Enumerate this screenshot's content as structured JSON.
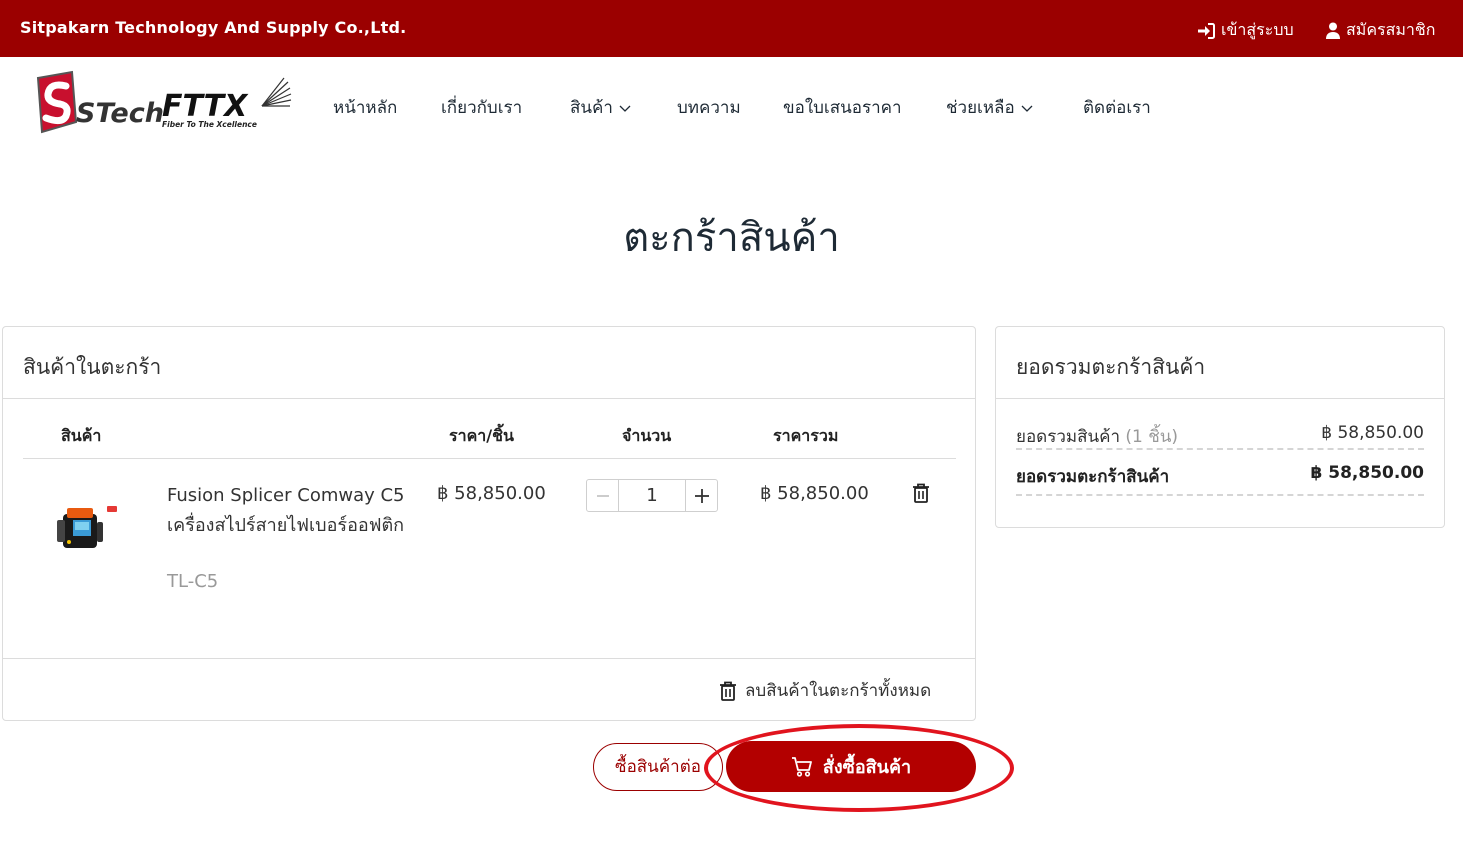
{
  "topbar": {
    "company": "Sitpakarn Technology And Supply Co.,Ltd.",
    "login_label": "เข้าสู่ระบบ",
    "register_label": "สมัครสมาชิก",
    "login_icon": "sign-in-icon",
    "register_icon": "user-icon",
    "bg_color": "#9b0000"
  },
  "logo": {
    "brand": "STech",
    "sub_brand": "FTTX",
    "tagline": "Fiber To The Xcellence"
  },
  "nav": {
    "items": [
      {
        "label": "หน้าหลัก",
        "dropdown": false
      },
      {
        "label": "เกี่ยวกับเรา",
        "dropdown": false
      },
      {
        "label": "สินค้า",
        "dropdown": true
      },
      {
        "label": "บทความ",
        "dropdown": false
      },
      {
        "label": "ขอใบเสนอราคา",
        "dropdown": false
      },
      {
        "label": "ช่วยเหลือ",
        "dropdown": true
      },
      {
        "label": "ติดต่อเรา",
        "dropdown": false
      }
    ]
  },
  "page": {
    "title": "ตะกร้าสินค้า"
  },
  "cart": {
    "heading": "สินค้าในตะกร้า",
    "columns": {
      "product": "สินค้า",
      "unit_price": "ราคา/ชิ้น",
      "quantity": "จำนวน",
      "total": "ราคารวม"
    },
    "items": [
      {
        "name": "Fusion Splicer Comway C5 เครื่องสไปร์สายไฟเบอร์ออฟติก",
        "sku": "TL-C5",
        "unit_price": "฿ 58,850.00",
        "quantity": "1",
        "total": "฿ 58,850.00"
      }
    ],
    "clear_all_label": "ลบสินค้าในตะกร้าทั้งหมด"
  },
  "summary": {
    "heading": "ยอดรวมตะกร้าสินค้า",
    "subtotal_label": "ยอดรวมสินค้า",
    "subtotal_count": "(1 ชิ้น)",
    "subtotal_value": "฿ 58,850.00",
    "total_label": "ยอดรวมตะกร้าสินค้า",
    "total_value": "฿ 58,850.00"
  },
  "actions": {
    "continue_label": "ซื้อสินค้าต่อ",
    "checkout_label": "สั่งซื้อสินค้า",
    "checkout_icon": "cart-icon",
    "accent_color": "#b30000",
    "highlight_color": "#e1141e"
  }
}
